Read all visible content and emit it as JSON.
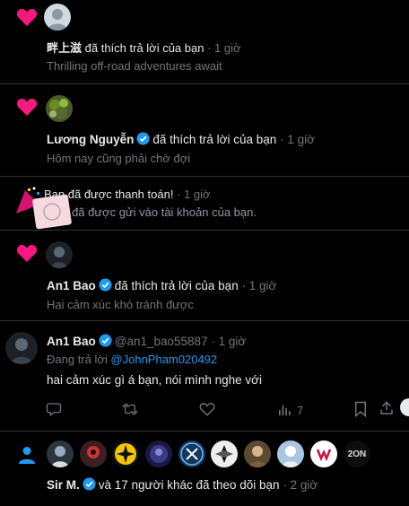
{
  "notifications": [
    {
      "type": "like",
      "name": "畔上滋",
      "action": "đã thích trả lời của bạn",
      "time": "· 1 giờ",
      "snippet": "Thrilling off-road adventures await"
    },
    {
      "type": "like",
      "name": "Lương Nguyễn",
      "action": "đã thích trả lời của bạn",
      "time": "· 1 giờ",
      "snippet": "Hôm nay cũng phải chờ đợi"
    },
    {
      "type": "payment",
      "title": "Bạn đã được thanh toán!",
      "time": "· 1 giờ",
      "body": "74 đã được gửi vào tài khoản của bạn."
    },
    {
      "type": "like",
      "name": "An1 Bao",
      "action": "đã thích trả lời của bạn",
      "time": "· 1 giờ",
      "snippet": "Hai cảm xúc khó tránh được"
    }
  ],
  "reply": {
    "name": "An1 Bao",
    "handle": "@an1_bao55887",
    "time": "· 1 giờ",
    "replying_prefix": "Đang trả lời",
    "replying_to": "@JohnPham020492",
    "text": "hai cảm xúc gì á bạn, nói mình nghe với",
    "views": "7"
  },
  "follow": {
    "avatar_labels": {
      "last": "2ON"
    },
    "name": "Sir M.",
    "text": "và 17 người khác đã theo dõi bạn",
    "time": "· 2 giờ"
  },
  "colors": {
    "heart": "#f91880",
    "verified": "#1d9bf0",
    "link": "#1d9bf0",
    "border": "#2f3336",
    "muted": "#71767b",
    "follow_icon": "#1d9bf0"
  }
}
